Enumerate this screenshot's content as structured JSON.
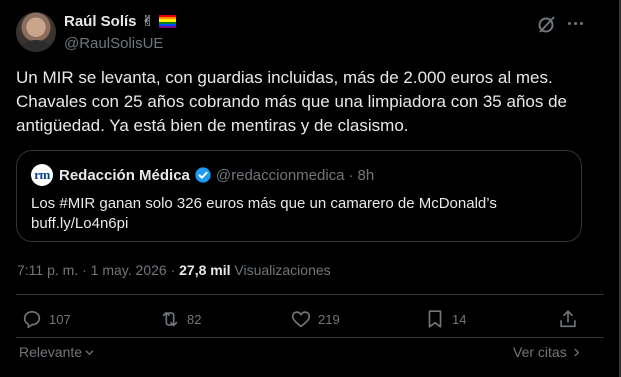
{
  "author": {
    "name": "Raúl Solís",
    "victory_emoji": "✌",
    "handle": "@RaulSolisUE"
  },
  "tweet": {
    "text": "Un MIR se levanta, con guardias incluidas, más de 2.000 euros al mes.\nChavales con 25 años cobrando más que una limpiadora con 35 años de\nantigüedad. Ya está bien de mentiras y de clasismo."
  },
  "quote": {
    "logo_text": "rm",
    "name": "Redacción Médica",
    "handle": "@redaccionmedica",
    "separator": "·",
    "time": "8h",
    "text": "Los #MIR ganan solo 326 euros más que un camarero de McDonald’s\nbuff.ly/Lo4n6pi"
  },
  "meta": {
    "time": "7:11 p. m.",
    "dot1": "·",
    "date": "1 may. 2026",
    "dot2": "·",
    "views_count": "27,8 mil",
    "views_label": "Visualizaciones"
  },
  "actions": {
    "replies": "107",
    "reposts": "82",
    "likes": "219",
    "bookmarks": "14"
  },
  "footer": {
    "sort_label": "Relevante",
    "quotes_label": "Ver citas"
  },
  "colors": {
    "background": "#000000",
    "text_primary": "#e7e9ea",
    "text_secondary": "#71767b",
    "border": "#2f3336",
    "verified_blue": "#1d9bf0"
  }
}
